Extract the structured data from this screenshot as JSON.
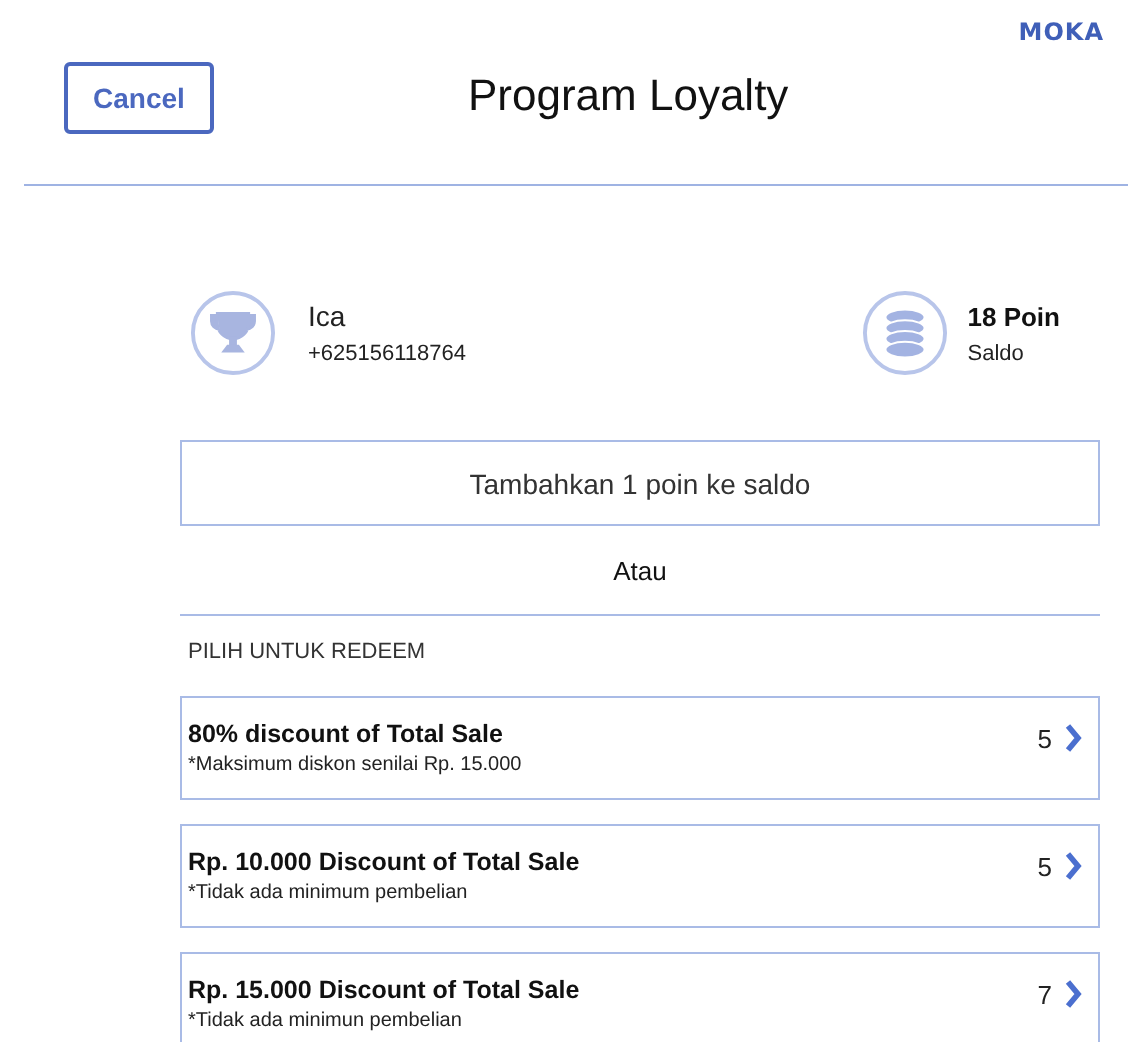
{
  "logo": "MOKA",
  "header": {
    "cancel": "Cancel",
    "title": "Program Loyalty"
  },
  "customer": {
    "name": "Ica",
    "phone": "+625156118764"
  },
  "balance": {
    "points": "18 Poin",
    "label": "Saldo"
  },
  "add_button": "Tambahkan 1 poin ke saldo",
  "separator": "Atau",
  "section_title": "PILIH UNTUK REDEEM",
  "rewards": [
    {
      "title": "80% discount of Total Sale",
      "note": "*Maksimum diskon senilai Rp. 15.000",
      "cost": "5"
    },
    {
      "title": "Rp. 10.000 Discount of Total Sale",
      "note": "*Tidak ada minimum pembelian",
      "cost": "5"
    },
    {
      "title": "Rp. 15.000 Discount of Total Sale",
      "note": "*Tidak ada minimun pembelian",
      "cost": "7"
    }
  ]
}
